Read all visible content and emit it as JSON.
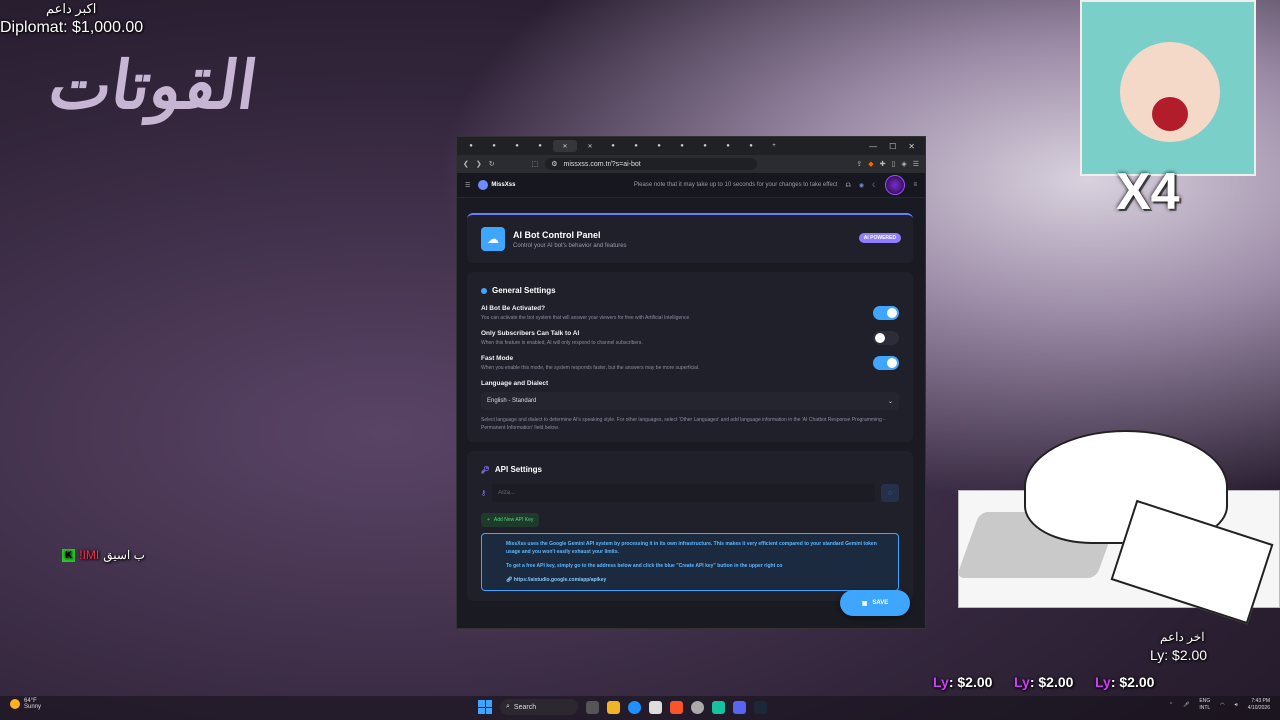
{
  "overlay": {
    "top_label": "اكبر داعم",
    "top_amount": "Diplomat: $1,000.00",
    "logo_text": "القوتات",
    "chat_badge": "K",
    "chat_name": "!IMI",
    "chat_text": "ب اسيق",
    "multiplier": "X4",
    "last_label": "اخر داعم",
    "last_amount": "Ly: $2.00",
    "ly_prefix": "Ly",
    "ly_amounts": [
      ": $2.00",
      ": $2.00",
      ": $2.00"
    ]
  },
  "browser": {
    "url": "missxss.com.tr/?s=ai-bot",
    "site_name": "MissXss",
    "notice": "Please note that it may take up to 10 seconds for your changes to take effect"
  },
  "header": {
    "title": "AI Bot Control Panel",
    "subtitle": "Control your AI bot's behavior and features",
    "badge": "AI POWERED"
  },
  "general": {
    "title": "General Settings",
    "settings": [
      {
        "title": "AI Bot Be Activated?",
        "desc": "You can activate the bot system that will answer your viewers for free with Artificial Intelligence",
        "on": true
      },
      {
        "title": "Only Subscribers Can Talk to AI",
        "desc": "When this feature is enabled, AI will only respond to channel subscribers.",
        "on": false
      },
      {
        "title": "Fast Mode",
        "desc": "When you enable this mode, the system responds faster, but the answers may be more superficial.",
        "on": true
      }
    ],
    "language_label": "Language and Dialect",
    "language_value": "English - Standard",
    "language_help": "Select language and dialect to determine AI's speaking style. For other languages, select 'Other Languages' and add language information in the 'AI Chatbot Response Programming - Permanent Information' field below."
  },
  "api": {
    "title": "API Settings",
    "key_placeholder": "AIza...",
    "add_button": "Add New API Key",
    "info_1": "MissXss uses the Google Gemini API system by processing it in its own infrastructure. This makes it very efficient compared to your standard Gemini token usage and you won't easily exhaust your limits.",
    "info_2": "To get a free API key, simply go to the address below and click the blue \"Create API key\" button in the upper right co",
    "link": "https://aistudio.google.com/app/apikey"
  },
  "save_label": "SAVE",
  "taskbar": {
    "temp": "64°F",
    "condition": "Sunny",
    "search": "Search",
    "lang_1": "ENG",
    "lang_2": "INTL",
    "time": "7:43 PM",
    "date": "4/10/2026"
  },
  "colors": {
    "accent": "#3ea6ff",
    "badge": "#8f7cff",
    "ly": "#d23cff"
  }
}
